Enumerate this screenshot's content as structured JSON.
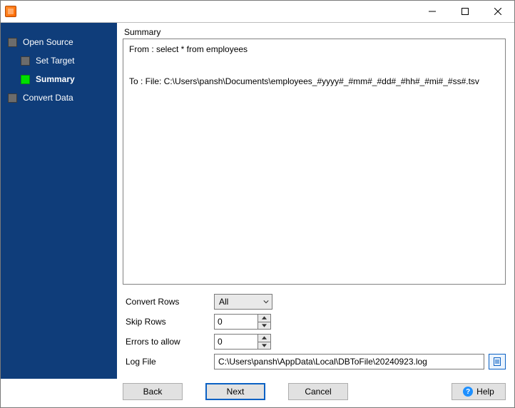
{
  "sidebar": {
    "items": [
      {
        "label": "Open Source"
      },
      {
        "label": "Set Target"
      },
      {
        "label": "Summary"
      },
      {
        "label": "Convert Data"
      }
    ]
  },
  "summary": {
    "heading": "Summary",
    "from": "From : select * from employees",
    "to": "To : File: C:\\Users\\pansh\\Documents\\employees_#yyyy#_#mm#_#dd#_#hh#_#mi#_#ss#.tsv"
  },
  "form": {
    "convert_rows": {
      "label": "Convert Rows",
      "value": "All"
    },
    "skip_rows": {
      "label": "Skip Rows",
      "value": "0"
    },
    "errors": {
      "label": "Errors to allow",
      "value": "0"
    },
    "log": {
      "label": "Log File",
      "value": "C:\\Users\\pansh\\AppData\\Local\\DBToFile\\20240923.log"
    }
  },
  "buttons": {
    "back": "Back",
    "next": "Next",
    "cancel": "Cancel",
    "help": "Help"
  }
}
